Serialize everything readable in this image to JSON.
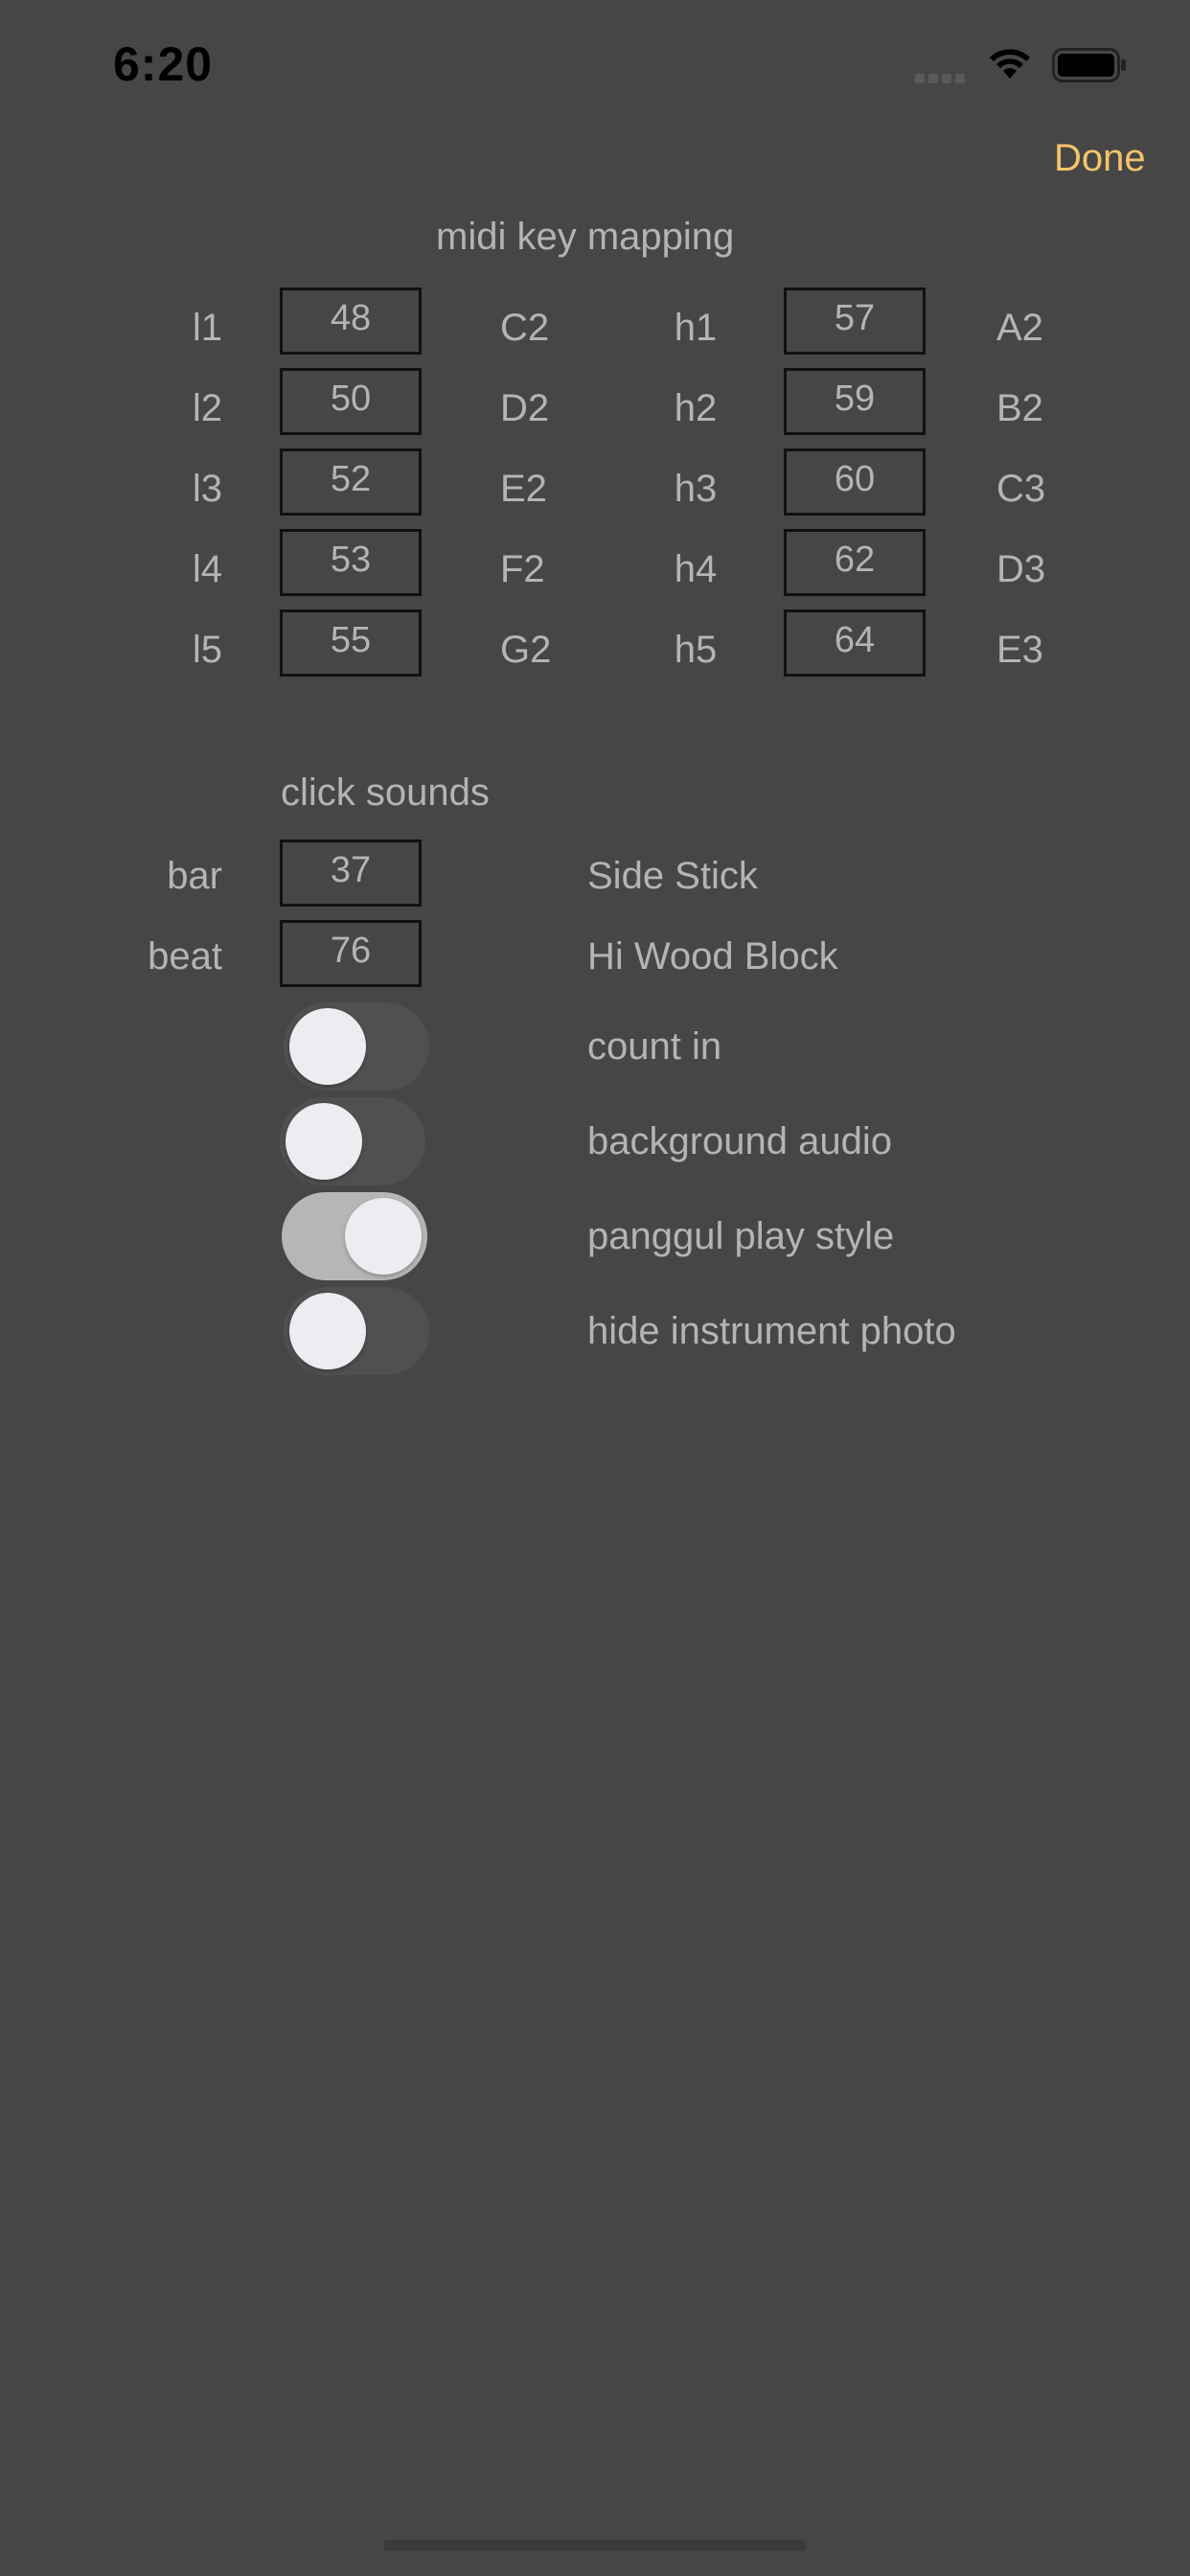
{
  "status_bar": {
    "time": "6:20",
    "icons": [
      "signal-icon",
      "wifi-icon",
      "battery-icon"
    ]
  },
  "nav": {
    "done_label": "Done",
    "accent_color": "#f4c46a"
  },
  "midi_mapping": {
    "title": "midi key mapping",
    "low": [
      {
        "key": "l1",
        "value": "48",
        "note": "C2"
      },
      {
        "key": "l2",
        "value": "50",
        "note": "D2"
      },
      {
        "key": "l3",
        "value": "52",
        "note": "E2"
      },
      {
        "key": "l4",
        "value": "53",
        "note": "F2"
      },
      {
        "key": "l5",
        "value": "55",
        "note": "G2"
      }
    ],
    "high": [
      {
        "key": "h1",
        "value": "57",
        "note": "A2"
      },
      {
        "key": "h2",
        "value": "59",
        "note": "B2"
      },
      {
        "key": "h3",
        "value": "60",
        "note": "C3"
      },
      {
        "key": "h4",
        "value": "62",
        "note": "D3"
      },
      {
        "key": "h5",
        "value": "64",
        "note": "E3"
      }
    ]
  },
  "click_sounds": {
    "title": "click sounds",
    "bar": {
      "label": "bar",
      "value": "37",
      "sound": "Side Stick"
    },
    "beat": {
      "label": "beat",
      "value": "76",
      "sound": "Hi Wood Block"
    }
  },
  "options": [
    {
      "label": "count in",
      "on": false
    },
    {
      "label": "background audio",
      "on": false
    },
    {
      "label": "panggul play style",
      "on": true
    },
    {
      "label": "hide instrument photo",
      "on": false
    }
  ]
}
